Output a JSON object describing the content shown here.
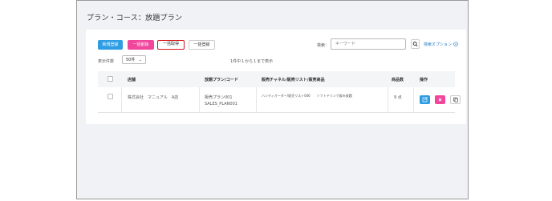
{
  "header": {
    "title": "プラン・コース：放題プラン"
  },
  "toolbar": {
    "new_label": "新規登録",
    "bulk_delete_label": "一括削除",
    "bulk_get_label": "一括取得",
    "bulk_register_label": "一括登録"
  },
  "search": {
    "label": "検索：",
    "placeholder": "キーワード",
    "options_label": "検索オプション"
  },
  "pagination": {
    "per_page_label": "表示件数",
    "per_page_value": "50件",
    "count_text": "1件中１から１まで表示"
  },
  "table": {
    "headers": [
      "店舗",
      "放題プラン/コード",
      "販売チャネル/販売リスト/販売商品",
      "商品数",
      "操作"
    ],
    "rows": [
      {
        "store": "株式会社　マニュアル　A店",
        "plan_name": "販売プラン001",
        "plan_code": "SALES_PLAN001",
        "channel": "ハンディオーダー/販売リスト006　　ソフトドリンク飲み放題",
        "count": "9 点"
      }
    ]
  },
  "icons": {
    "search": "search-icon",
    "options": "chevron-circle-icon",
    "edit": "edit-icon",
    "delete": "close-icon",
    "copy": "copy-icon"
  },
  "colors": {
    "primary": "#2e9de4",
    "danger": "#f0479c",
    "highlight": "#d9151a"
  }
}
